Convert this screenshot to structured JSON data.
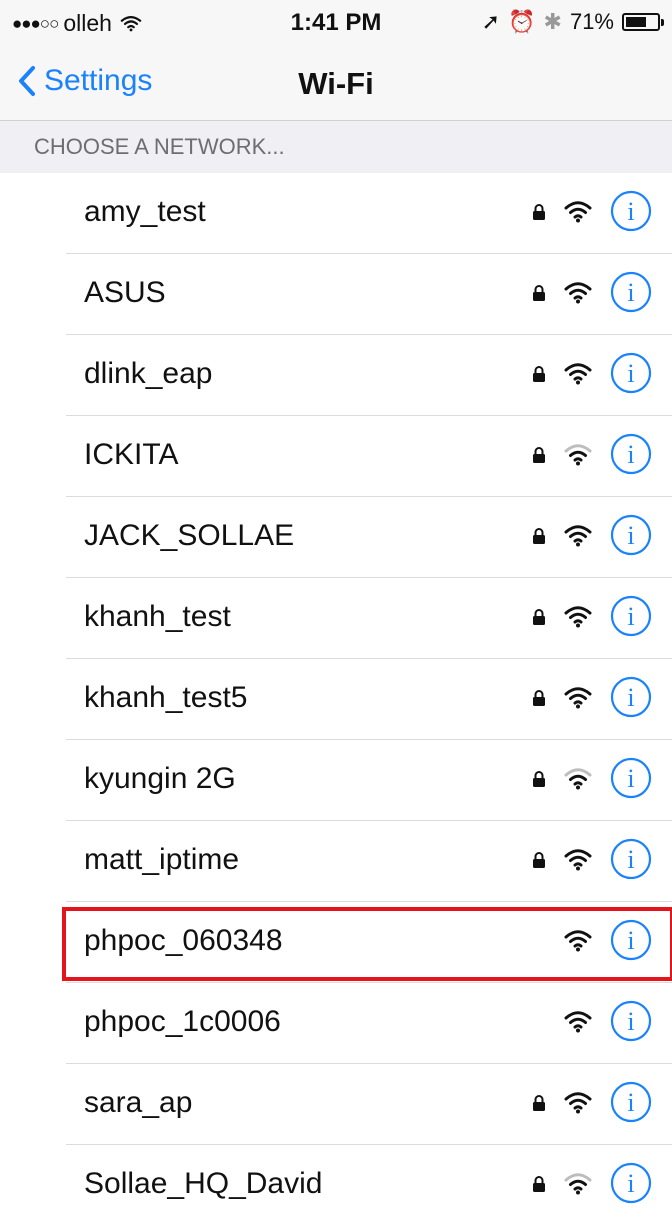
{
  "status_bar": {
    "signal_dots": "●●●○○",
    "carrier": "olleh",
    "time": "1:41 PM",
    "battery_text": "71%",
    "battery_level": 0.71,
    "location_icon": "➚",
    "alarm_icon": "⏰",
    "bluetooth_icon": "✱"
  },
  "nav": {
    "back_label": "Settings",
    "title": "Wi-Fi"
  },
  "section": {
    "header": "CHOOSE A NETWORK..."
  },
  "networks": [
    {
      "name": "amy_test",
      "locked": true,
      "strength": 3
    },
    {
      "name": "ASUS",
      "locked": true,
      "strength": 3
    },
    {
      "name": "dlink_eap",
      "locked": true,
      "strength": 3
    },
    {
      "name": "ICKITA",
      "locked": true,
      "strength": 2
    },
    {
      "name": "JACK_SOLLAE",
      "locked": true,
      "strength": 3
    },
    {
      "name": "khanh_test",
      "locked": true,
      "strength": 3
    },
    {
      "name": "khanh_test5",
      "locked": true,
      "strength": 3
    },
    {
      "name": "kyungin 2G",
      "locked": true,
      "strength": 2
    },
    {
      "name": "matt_iptime",
      "locked": true,
      "strength": 3
    },
    {
      "name": "phpoc_060348",
      "locked": false,
      "strength": 3,
      "highlighted": true
    },
    {
      "name": "phpoc_1c0006",
      "locked": false,
      "strength": 3
    },
    {
      "name": "sara_ap",
      "locked": true,
      "strength": 3
    },
    {
      "name": "Sollae_HQ_David",
      "locked": true,
      "strength": 2
    }
  ],
  "colors": {
    "accent": "#1a82fb",
    "highlight": "#e3141b",
    "icon_active": "#111111",
    "icon_dim": "#bdbdbd"
  }
}
